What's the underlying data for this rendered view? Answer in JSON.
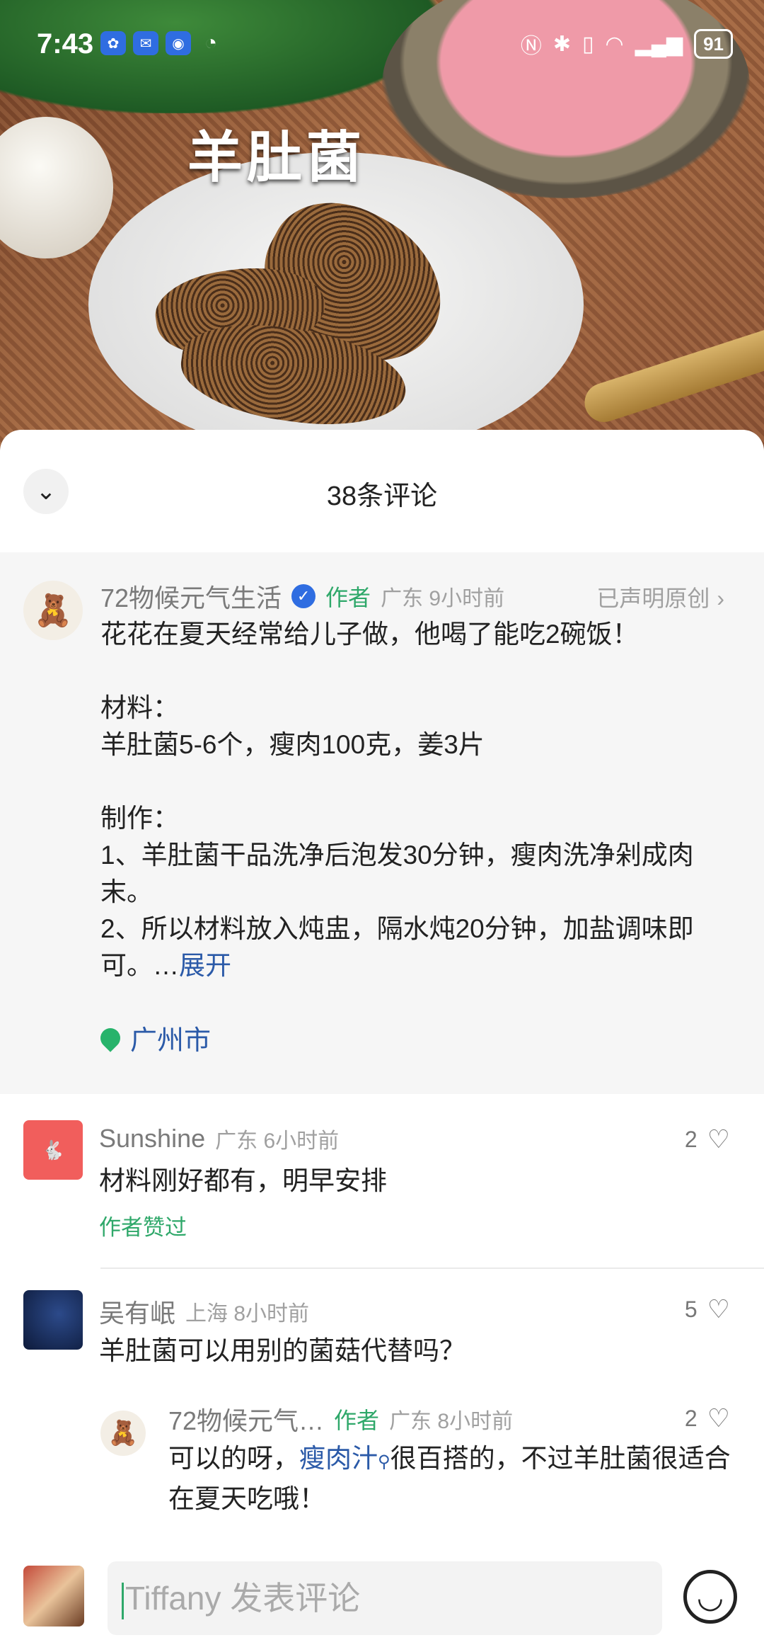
{
  "status_bar": {
    "time": "7:43",
    "battery": "91"
  },
  "video": {
    "title": "羊肚菌"
  },
  "sheet": {
    "comment_count": "38条评论"
  },
  "author_post": {
    "name": "72物候元气生活",
    "author_tag": "作者",
    "location_time": "广东 9小时前",
    "original": "已声明原创",
    "lines": [
      "花花在夏天经常给儿子做，他喝了能吃2碗饭！",
      "",
      "材料：",
      "羊肚菌5-6个，瘦肉100克，姜3片",
      "",
      "制作：",
      "1、羊肚菌干品洗净后泡发30分钟，瘦肉洗净剁成肉末。",
      "2、所以材料放入炖盅，隔水炖20分钟，加盐调味即可。…"
    ],
    "expand": "展开",
    "place": "广州市"
  },
  "comments": [
    {
      "name": "Sunshine",
      "meta": "广东 6小时前",
      "text": "材料刚好都有，明早安排",
      "likes": "2",
      "liked_by_author": "作者赞过"
    },
    {
      "name": "吴有岷",
      "meta": "上海 8小时前",
      "text": "羊肚菌可以用别的菌菇代替吗？",
      "likes": "5"
    }
  ],
  "reply": {
    "name": "72物候元气…",
    "author_tag": "作者",
    "meta": "广东 8小时前",
    "likes": "2",
    "text_before": "可以的呀，",
    "link": "瘦肉汁",
    "text_after": "很百搭的，不过羊肚菌很适合在夏天吃哦！"
  },
  "input": {
    "placeholder": "Tiffany 发表评论"
  }
}
